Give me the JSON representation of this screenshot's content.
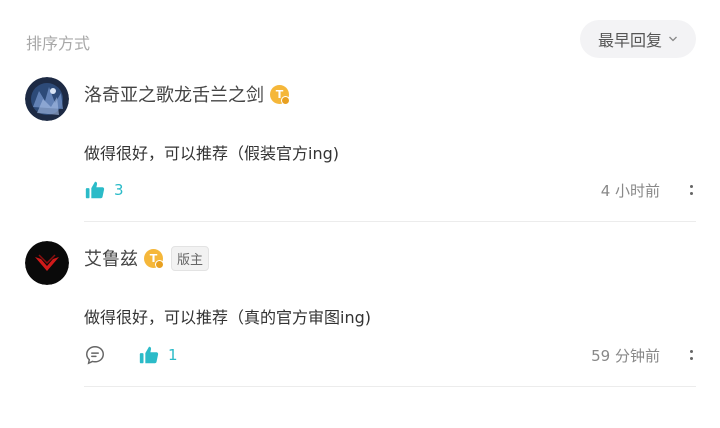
{
  "sort": {
    "label": "排序方式",
    "selected": "最早回复"
  },
  "comments": [
    {
      "username": "洛奇亚之歌龙舌兰之剑",
      "badge": "T",
      "content": "做得很好，可以推荐（假装官方ing)",
      "likes": "3",
      "time": "4 小时前"
    },
    {
      "username": "艾鲁兹",
      "badge": "T",
      "role": "版主",
      "content": "做得很好，可以推荐（真的官方审图ing)",
      "likes": "1",
      "time": "59 分钟前"
    }
  ],
  "colors": {
    "accent": "#2bbbc8",
    "badge": "#f5b73a"
  }
}
